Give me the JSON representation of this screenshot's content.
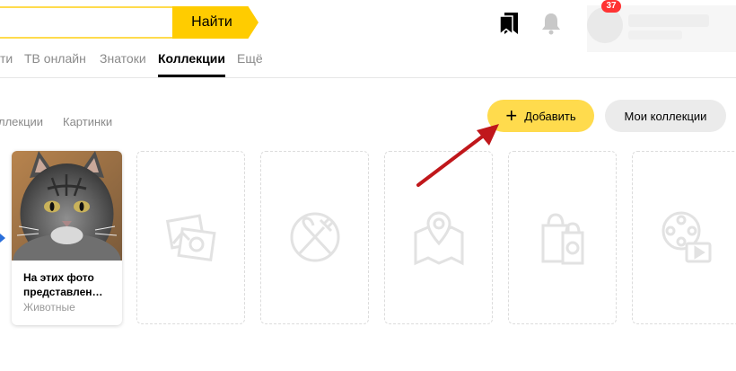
{
  "search": {
    "button_label": "Найти",
    "value": ""
  },
  "header": {
    "notifications_count": "37"
  },
  "nav": {
    "items": [
      {
        "label": "ти",
        "active": false
      },
      {
        "label": "ТВ онлайн",
        "active": false
      },
      {
        "label": "Знатоки",
        "active": false
      },
      {
        "label": "Коллекции",
        "active": true
      },
      {
        "label": "Ещё",
        "active": false
      }
    ]
  },
  "subtabs": [
    "ллекции",
    "Картинки"
  ],
  "actions": {
    "add_label": "Добавить",
    "my_collections_label": "Мои коллекции"
  },
  "card": {
    "title": "На этих фото представлен…",
    "category": "Животные"
  },
  "placeholders": [
    {
      "icon": "photo-collage-icon"
    },
    {
      "icon": "utensils-icon"
    },
    {
      "icon": "map-pin-icon"
    },
    {
      "icon": "shopping-bag-icon"
    },
    {
      "icon": "film-reel-icon"
    }
  ],
  "colors": {
    "accent": "#ffdb4d",
    "button_yellow": "#ffcc00",
    "badge": "#ff3333",
    "arrow": "#c0171b"
  }
}
